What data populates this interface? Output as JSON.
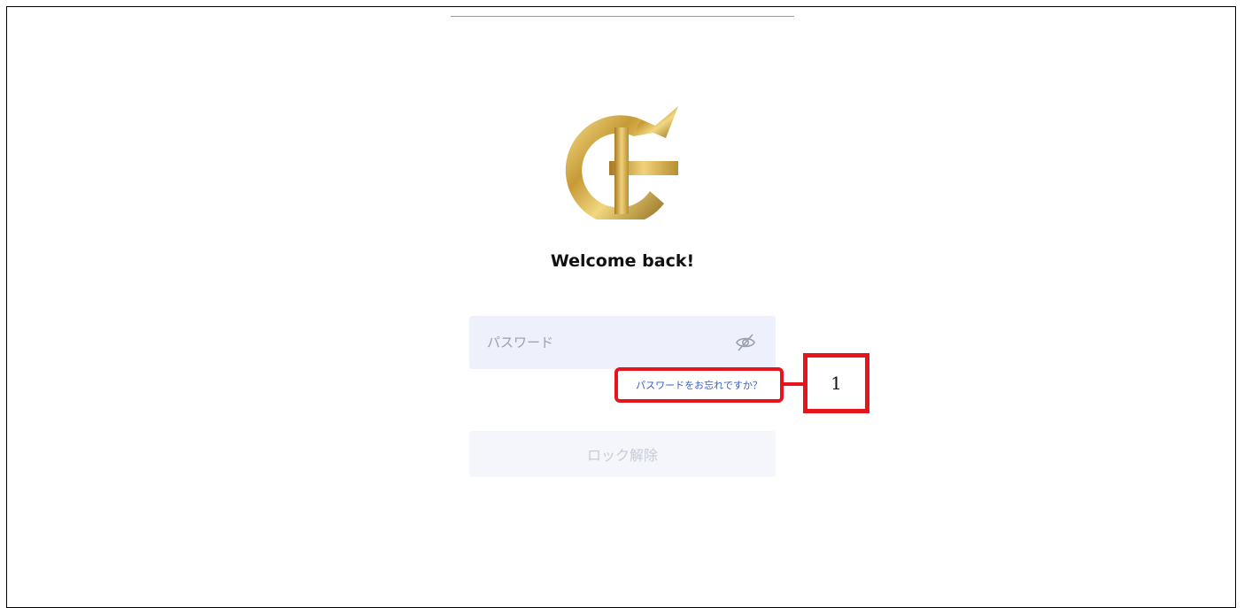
{
  "header": {
    "welcome_text": "Welcome back!"
  },
  "logo": {
    "icon": "gold-c-plus-arrow-logo",
    "colors": [
      "#c9a546",
      "#f3dc87",
      "#8a6418"
    ]
  },
  "password": {
    "placeholder": "パスワード",
    "value": "",
    "visibility_icon": "eye-off-icon"
  },
  "forgot_password": {
    "label": "パスワードをお忘れですか？"
  },
  "unlock": {
    "label": "ロック解除",
    "enabled": false
  },
  "annotation": {
    "number": "1",
    "color": "#e8141b"
  }
}
